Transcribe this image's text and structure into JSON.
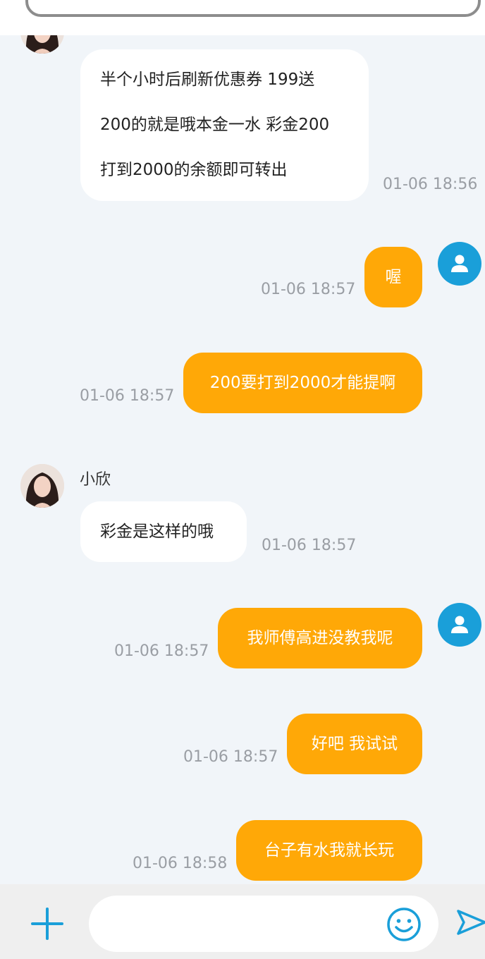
{
  "messages": [
    {
      "lines": [
        "半个小时后刷新优惠券 199送",
        "200的就是哦本金一水 彩金200",
        "打到2000的余额即可转出"
      ],
      "time": "01-06 18:56"
    },
    {
      "text": "喔",
      "time": "01-06 18:57"
    },
    {
      "text": "200要打到2000才能提啊",
      "time": "01-06 18:57"
    },
    {
      "sender": "小欣",
      "text": "彩金是这样的哦",
      "time": "01-06 18:57"
    },
    {
      "text": "我师傅高进没教我呢",
      "time": "01-06 18:57"
    },
    {
      "text": "好吧 我试试",
      "time": "01-06 18:57"
    },
    {
      "text": "台子有水我就长玩",
      "time": "01-06 18:58"
    }
  ],
  "input": {
    "placeholder": ""
  },
  "colors": {
    "outgoing": "#ffa807",
    "incoming": "#ffffff",
    "accent": "#1a9fd9",
    "background": "#f1f5f9"
  },
  "icons": {
    "add": "plus-icon",
    "emoji": "smiley-icon",
    "send": "send-icon",
    "user": "user-icon"
  }
}
